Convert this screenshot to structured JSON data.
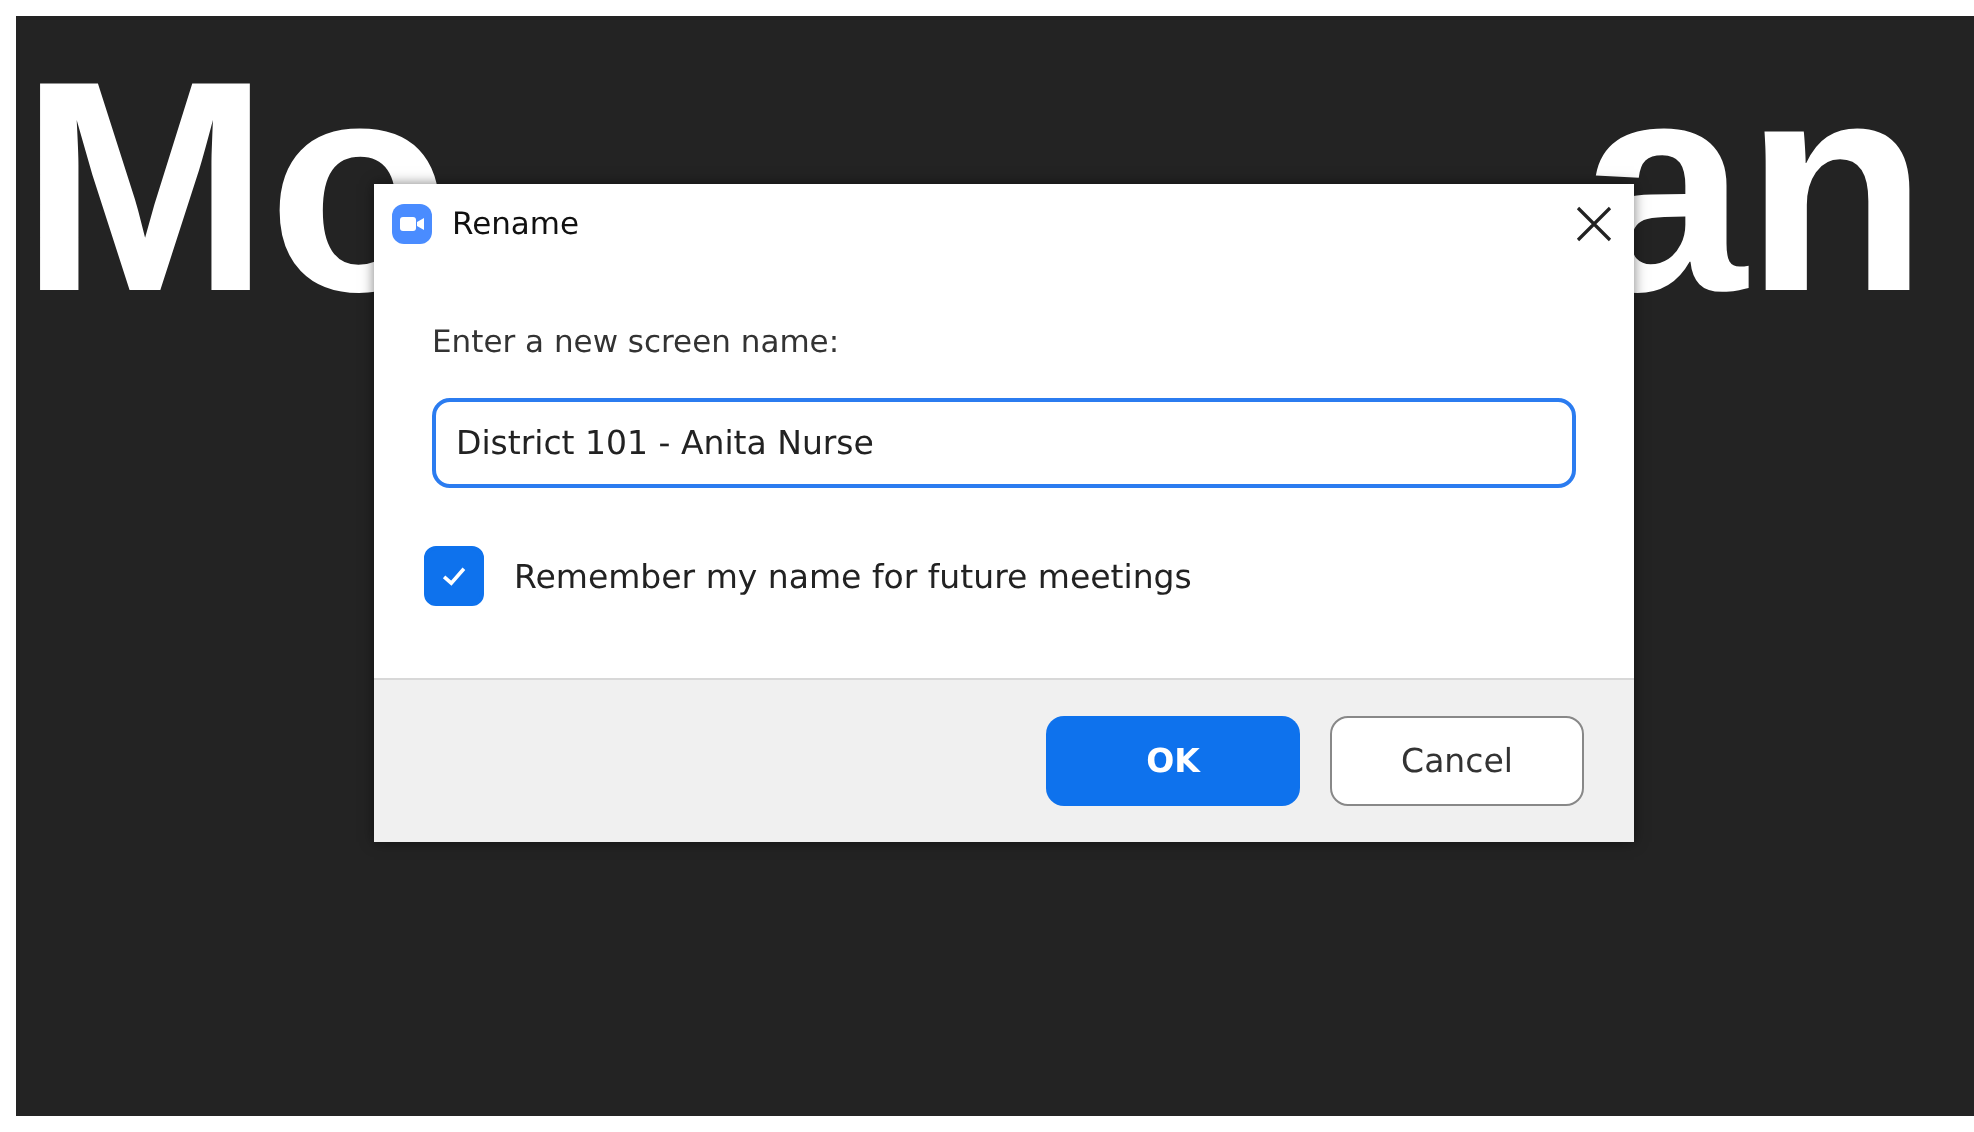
{
  "background_name_parts": [
    "Mo",
    "an"
  ],
  "dialog": {
    "title": "Rename",
    "prompt": "Enter a new screen name:",
    "name_field": {
      "value": "District 101 - Anita Nurse"
    },
    "remember": {
      "label": "Remember my name for future meetings",
      "checked": true
    },
    "buttons": [
      {
        "label": "OK",
        "kind": "primary"
      },
      {
        "label": "Cancel",
        "kind": "secondary"
      }
    ]
  }
}
